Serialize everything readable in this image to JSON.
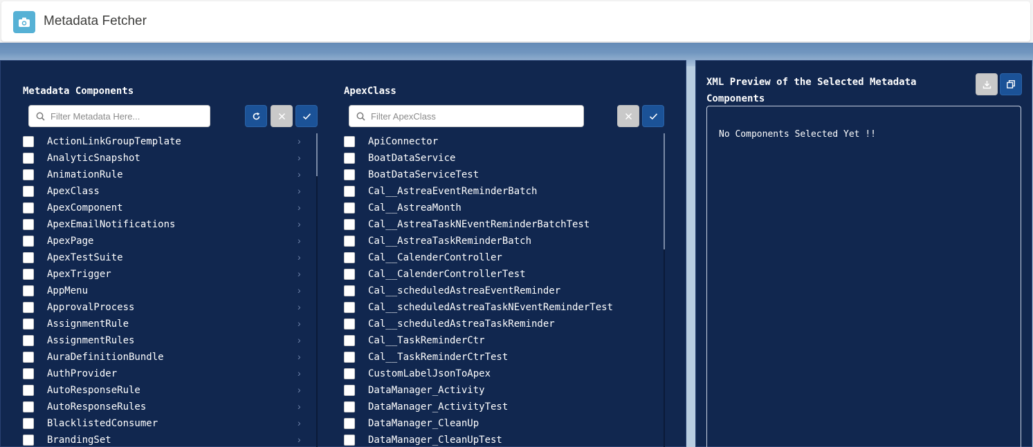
{
  "header": {
    "app_title": "Metadata Fetcher",
    "app_icon": "camera-icon"
  },
  "left_panel": {
    "metadata": {
      "title": "Metadata Components",
      "search_placeholder": "Filter Metadata Here...",
      "items": [
        "ActionLinkGroupTemplate",
        "AnalyticSnapshot",
        "AnimationRule",
        "ApexClass",
        "ApexComponent",
        "ApexEmailNotifications",
        "ApexPage",
        "ApexTestSuite",
        "ApexTrigger",
        "AppMenu",
        "ApprovalProcess",
        "AssignmentRule",
        "AssignmentRules",
        "AuraDefinitionBundle",
        "AuthProvider",
        "AutoResponseRule",
        "AutoResponseRules",
        "BlacklistedConsumer",
        "BrandingSet"
      ]
    },
    "apexclass": {
      "title": "ApexClass",
      "search_placeholder": "Filter ApexClass",
      "items": [
        "ApiConnector",
        "BoatDataService",
        "BoatDataServiceTest",
        "Cal__AstreaEventReminderBatch",
        "Cal__AstreaMonth",
        "Cal__AstreaTaskNEventReminderBatchTest",
        "Cal__AstreaTaskReminderBatch",
        "Cal__CalenderController",
        "Cal__CalenderControllerTest",
        "Cal__scheduledAstreaEventReminder",
        "Cal__scheduledAstreaTaskNEventReminderTest",
        "Cal__scheduledAstreaTaskReminder",
        "Cal__TaskReminderCtr",
        "Cal__TaskReminderCtrTest",
        "CustomLabelJsonToApex",
        "DataManager_Activity",
        "DataManager_ActivityTest",
        "DataManager_CleanUp",
        "DataManager_CleanUpTest"
      ]
    }
  },
  "right_panel": {
    "title_line1": "XML Preview of the Selected Metadata",
    "title_line2": "Components",
    "empty_message": "No Components Selected Yet !!"
  }
}
